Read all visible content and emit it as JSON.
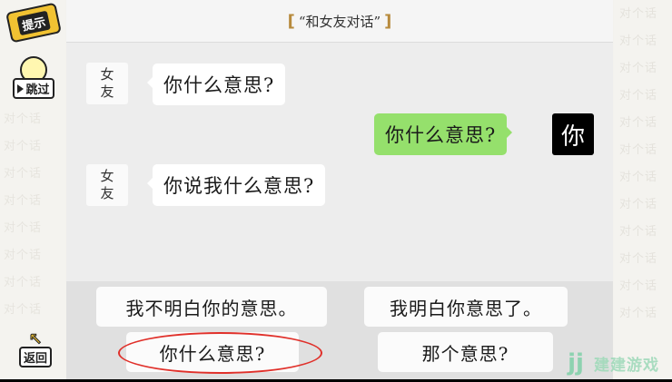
{
  "header": {
    "title": "“和女友对话”",
    "bracket_left": "[",
    "bracket_right": "]"
  },
  "chat": {
    "messages": [
      {
        "side": "left",
        "avatar_line1": "女",
        "avatar_line2": "友",
        "text": "你什么意思?"
      },
      {
        "side": "right",
        "avatar": "你",
        "text": "你什么意思?"
      },
      {
        "side": "left",
        "avatar_line1": "女",
        "avatar_line2": "友",
        "text": "你说我什么意思?"
      }
    ]
  },
  "options": [
    {
      "text": "我不明白你的意思。"
    },
    {
      "text": "我明白你意思了。"
    },
    {
      "text": "你什么意思?",
      "circled": true
    },
    {
      "text": "那个意思?"
    }
  ],
  "side_buttons": {
    "hint": {
      "label": "提示",
      "icon": "hint-card-icon"
    },
    "skip": {
      "label": "跳过",
      "icon": "lightbulb-icon"
    },
    "back": {
      "label": "返回",
      "icon": "back-arrow-icon"
    }
  },
  "watermark": {
    "logo_text": "建建游戏",
    "mark": "jj",
    "bg_text": "对个话"
  },
  "colors": {
    "bubble_green": "#95e06c",
    "circle_red": "#e0302a",
    "title_bracket": "#b78a3c"
  }
}
